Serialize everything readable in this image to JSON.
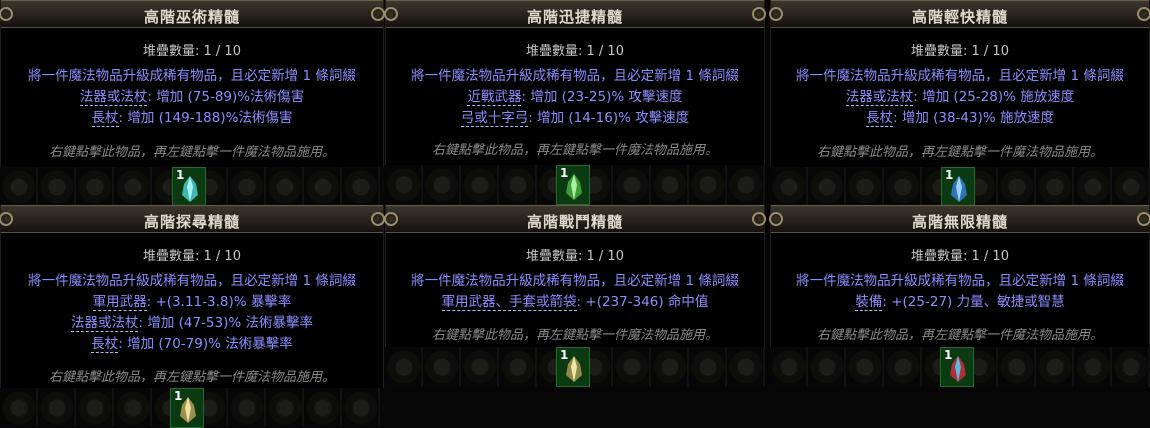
{
  "stack_label": "堆疊數量: 1 / 10",
  "description": "將一件魔法物品升級成稀有物品，且必定新增 1 條詞綴",
  "usage_hint": "右鍵點擊此物品，再左鍵點擊一件魔法物品施用。",
  "item_count": "1",
  "colors": {
    "mod_text": "#8c8cff",
    "title_text": "#ddd8cc",
    "hint_text": "#8a8a8a"
  },
  "tooltips": [
    {
      "title": "高階巫術精髓",
      "mods": [
        {
          "tag": "法器或法杖",
          "rest": ": 增加 (75-89)%法術傷害"
        },
        {
          "tag": "長杖",
          "rest": ": 增加 (149-188)%法術傷害"
        }
      ],
      "icon": "crystal-essence-cyan-icon"
    },
    {
      "title": "高階迅捷精髓",
      "mods": [
        {
          "tag": "近戰武器",
          "rest": ": 增加 (23-25)% 攻擊速度"
        },
        {
          "tag": "弓或十字弓",
          "rest": ": 增加 (14-16)% 攻擊速度"
        }
      ],
      "icon": "crystal-essence-green-icon"
    },
    {
      "title": "高階輕快精髓",
      "mods": [
        {
          "tag": "法器或法杖",
          "rest": ": 增加 (25-28)% 施放速度"
        },
        {
          "tag": "長杖",
          "rest": ": 增加 (38-43)% 施放速度"
        }
      ],
      "icon": "crystal-essence-blue-icon"
    },
    {
      "title": "高階探尋精髓",
      "mods": [
        {
          "tag": "軍用武器",
          "rest": ": +(3.11-3.8)% 暴擊率"
        },
        {
          "tag": "法器或法杖",
          "rest": ": 增加 (47-53)% 法術暴擊率"
        },
        {
          "tag": "長杖",
          "rest": ": 增加 (70-79)% 法術暴擊率"
        }
      ],
      "icon": "crystal-essence-gold-icon"
    },
    {
      "title": "高階戰鬥精髓",
      "mods": [
        {
          "tag": "軍用武器、手套或箭袋",
          "rest": ": +(237-346) 命中值"
        }
      ],
      "icon": "crystal-essence-gold-icon"
    },
    {
      "title": "高階無限精髓",
      "mods": [
        {
          "tag": "裝備",
          "rest": ": +(25-27) 力量、敏捷或智慧"
        }
      ],
      "icon": "crystal-essence-red-icon"
    }
  ]
}
